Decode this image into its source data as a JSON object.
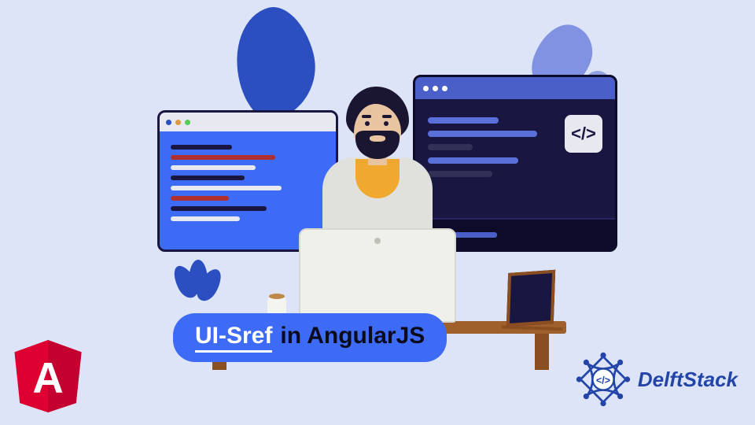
{
  "title": {
    "highlight": "UI-Sref",
    "rest": "in AngularJS"
  },
  "logos": {
    "angular_letter": "A",
    "delftstack_text": "DelftStack",
    "code_glyph": "</>"
  },
  "colors": {
    "bg": "#dde4f7",
    "accent_blue": "#3d6bf5",
    "dark_navy": "#1a1642",
    "angular_red": "#dd0031",
    "delft_blue": "#2345a8"
  }
}
